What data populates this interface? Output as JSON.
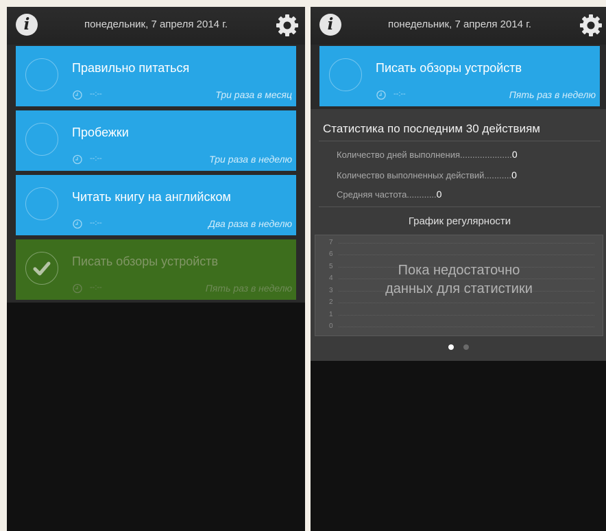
{
  "date": "понедельник, 7 апреля 2014 г.",
  "info_label": "i",
  "time_placeholder": "--:--",
  "tasks": [
    {
      "title": "Правильно питаться",
      "frequency": "Три раза в месяц",
      "done": false
    },
    {
      "title": "Пробежки",
      "frequency": "Три раза в неделю",
      "done": false
    },
    {
      "title": "Читать книгу на английском",
      "frequency": "Два раза в неделю",
      "done": false
    },
    {
      "title": "Писать обзоры устройств",
      "frequency": "Пять раз в неделю",
      "done": true
    }
  ],
  "detail": {
    "task_title": "Писать обзоры устройств",
    "frequency": "Пять раз в неделю",
    "stats_title": "Статистика по последним 30 действиям",
    "stats": [
      {
        "label": "Количество дней выполнения.....................",
        "value": "0"
      },
      {
        "label": "Количество выполненных действий...........",
        "value": "0"
      },
      {
        "label": "Средняя частота............",
        "value": "0"
      }
    ],
    "graph_title": "График регулярности",
    "y_ticks": [
      "7",
      "6",
      "5",
      "4",
      "3",
      "2",
      "1",
      "0"
    ],
    "no_data_line1": "Пока недостаточно",
    "no_data_line2": "данных для статистики",
    "page_count": 2,
    "current_page": 1
  },
  "colors": {
    "task_blue": "#28a6e6",
    "task_done_green": "#3d6e1d",
    "background": "#111111"
  },
  "icons": [
    "info-icon",
    "gear-icon",
    "clock-icon",
    "checkmark-icon"
  ]
}
